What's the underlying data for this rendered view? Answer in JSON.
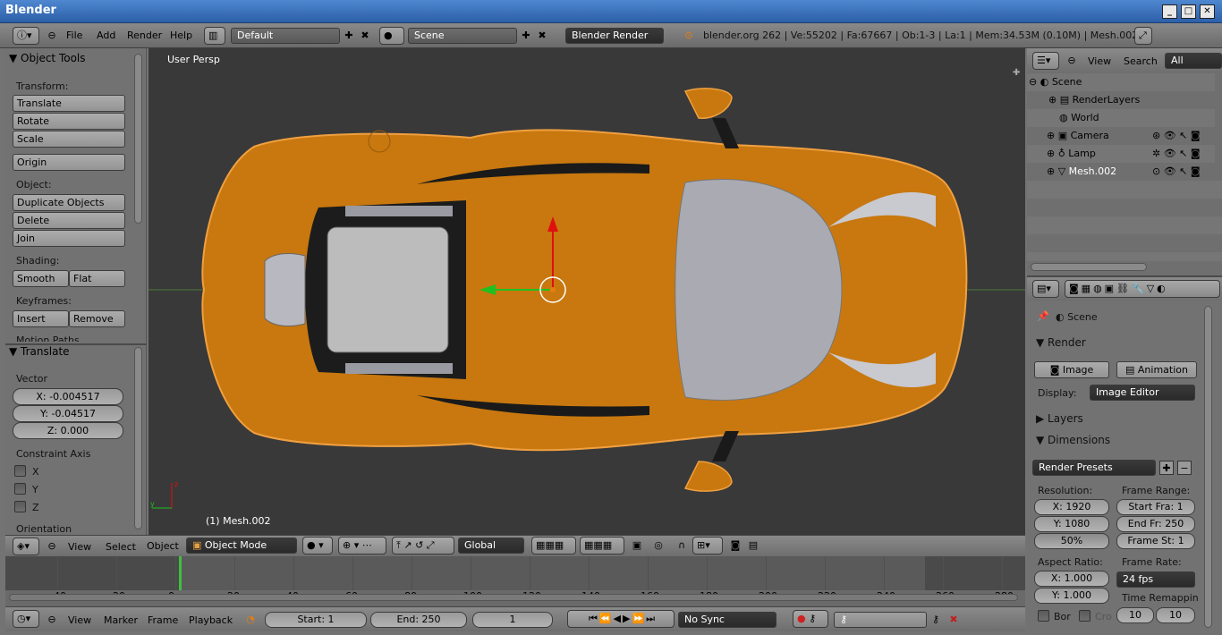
{
  "window": {
    "title": "Blender"
  },
  "topbar": {
    "menus": [
      "File",
      "Add",
      "Render",
      "Help"
    ],
    "screen_layout": "Default",
    "scene": "Scene",
    "render_engine": "Blender Render",
    "stats": "blender.org 262 | Ve:55202 | Fa:67667 | Ob:1-3 | La:1 | Mem:34.53M (0.10M) | Mesh.002"
  },
  "toolshelf": {
    "title": "Object Tools",
    "transform_label": "Transform:",
    "translate": "Translate",
    "rotate": "Rotate",
    "scale": "Scale",
    "origin": "Origin",
    "object_label": "Object:",
    "duplicate": "Duplicate Objects",
    "delete": "Delete",
    "join": "Join",
    "shading_label": "Shading:",
    "smooth": "Smooth",
    "flat": "Flat",
    "keyframes_label": "Keyframes:",
    "insert": "Insert",
    "remove": "Remove",
    "motion_paths_label": "Motion Paths"
  },
  "operator": {
    "title": "Translate",
    "vector_label": "Vector",
    "x": "X: -0.004517",
    "y": "Y: -0.04517",
    "z": "Z: 0.000",
    "constraint_label": "Constraint Axis",
    "cx": "X",
    "cy": "Y",
    "cz": "Z",
    "orientation_label": "Orientation"
  },
  "viewport": {
    "view_name": "User Persp",
    "object_info": "(1) Mesh.002",
    "header": {
      "menus": [
        "View",
        "Select",
        "Object"
      ],
      "mode": "Object Mode",
      "orientation": "Global"
    },
    "colors": {
      "car_body": "#c8780f",
      "background": "#393939",
      "selection_outline": "#f0a040"
    }
  },
  "timeline": {
    "ticks": [
      "-40",
      "-20",
      "0",
      "20",
      "40",
      "60",
      "80",
      "100",
      "120",
      "140",
      "160",
      "180",
      "200",
      "220",
      "240",
      "260",
      "280"
    ],
    "current_frame": "1",
    "header": {
      "menus": [
        "View",
        "Marker",
        "Frame",
        "Playback"
      ],
      "start": "Start: 1",
      "end": "End: 250",
      "frame": "1",
      "sync": "No Sync"
    }
  },
  "outliner": {
    "menus": [
      "View",
      "Search"
    ],
    "display": "All Scenes",
    "items": [
      "Scene",
      "RenderLayers",
      "World",
      "Camera",
      "Lamp",
      "Mesh.002"
    ]
  },
  "properties": {
    "context": "Scene",
    "render_panel": "Render",
    "image_btn": "Image",
    "animation_btn": "Animation",
    "display_label": "Display:",
    "display_value": "Image Editor",
    "layers_panel": "Layers",
    "dimensions_panel": "Dimensions",
    "presets": "Render Presets",
    "resolution_label": "Resolution:",
    "res_x": "X: 1920",
    "res_y": "Y: 1080",
    "res_pct": "50%",
    "frame_range_label": "Frame Range:",
    "start_fra": "Start Fra: 1",
    "end_fr": "End Fr: 250",
    "frame_st": "Frame St: 1",
    "aspect_label": "Aspect Ratio:",
    "asp_x": "X: 1.000",
    "asp_y": "Y: 1.000",
    "frame_rate_label": "Frame Rate:",
    "fps": "24 fps",
    "time_remap_label": "Time Remappin",
    "remap_old": "10",
    "remap_new": "10",
    "border": "Bor",
    "crop": "Cro"
  }
}
